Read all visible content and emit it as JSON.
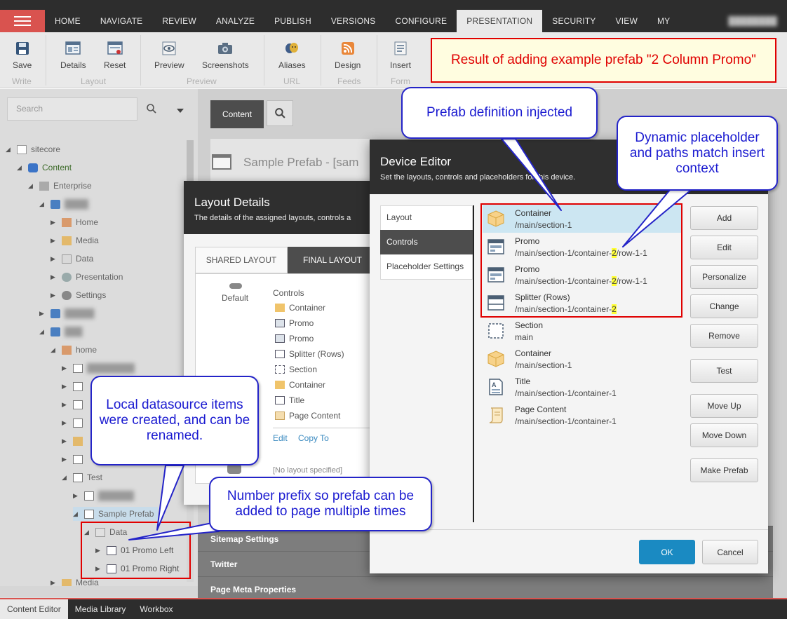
{
  "topnav": {
    "tabs": [
      "HOME",
      "NAVIGATE",
      "REVIEW",
      "ANALYZE",
      "PUBLISH",
      "VERSIONS",
      "CONFIGURE",
      "PRESENTATION",
      "SECURITY",
      "VIEW",
      "MY TOOLBAR"
    ],
    "active": "PRESENTATION"
  },
  "ribbon": {
    "buttons": {
      "save": "Save",
      "details": "Details",
      "reset": "Reset",
      "preview": "Preview",
      "screenshots": "Screenshots",
      "aliases": "Aliases",
      "design": "Design",
      "insert": "Insert"
    },
    "groups": {
      "write": "Write",
      "layout": "Layout",
      "preview": "Preview",
      "url": "URL",
      "feeds": "Feeds",
      "form": "Form"
    }
  },
  "search": {
    "placeholder": "Search"
  },
  "tree": {
    "sitecore": "sitecore",
    "content": "Content",
    "enterprise": "Enterprise",
    "home": "Home",
    "media": "Media",
    "data": "Data",
    "presentation": "Presentation",
    "settings": "Settings",
    "home_lower": "home",
    "test": "Test",
    "sample_prefab": "Sample Prefab",
    "data_folder": "Data",
    "promo_left": "01 Promo Left",
    "promo_right": "01 Promo Right",
    "media_partial": "Media"
  },
  "content_editor": {
    "content_tab": "Content",
    "item_title": "Sample Prefab - [sam",
    "sections": [
      "Sitemap Settings",
      "Twitter",
      "Page Meta Properties"
    ]
  },
  "layout_details": {
    "title": "Layout Details",
    "subtitle": "The details of the assigned layouts, controls a",
    "tab_shared": "SHARED LAYOUT",
    "tab_final": "FINAL LAYOUT",
    "device": "Default",
    "controls_label": "Controls",
    "controls": [
      "Container",
      "Promo",
      "Promo",
      "Splitter (Rows)",
      "Section",
      "Container",
      "Title",
      "Page Content"
    ],
    "edit": "Edit",
    "copy_to": "Copy To",
    "no_layout": "[No layout specified]"
  },
  "device_editor": {
    "title": "Device Editor",
    "subtitle": "Set the layouts, controls and placeholders for this device.",
    "nav": [
      "Layout",
      "Controls",
      "Placeholder Settings"
    ],
    "nav_active": "Controls",
    "controls": [
      {
        "name": "Container",
        "path_pre": "/main/section-1",
        "hl": "",
        "path_post": ""
      },
      {
        "name": "Promo",
        "path_pre": "/main/section-1/container-",
        "hl": "2",
        "path_post": "/row-1-1"
      },
      {
        "name": "Promo",
        "path_pre": "/main/section-1/container-",
        "hl": "2",
        "path_post": "/row-1-1"
      },
      {
        "name": "Splitter (Rows)",
        "path_pre": "/main/section-1/container-",
        "hl": "2",
        "path_post": ""
      },
      {
        "name": "Section",
        "path_pre": "main",
        "hl": "",
        "path_post": ""
      },
      {
        "name": "Container",
        "path_pre": "/main/section-1",
        "hl": "",
        "path_post": ""
      },
      {
        "name": "Title",
        "path_pre": "/main/section-1/container-1",
        "hl": "",
        "path_post": ""
      },
      {
        "name": "Page Content",
        "path_pre": "/main/section-1/container-1",
        "hl": "",
        "path_post": ""
      }
    ],
    "buttons": [
      "Add",
      "Edit",
      "Personalize",
      "Change",
      "Remove",
      "Test",
      "Move Up",
      "Move Down",
      "Make Prefab"
    ],
    "ok": "OK",
    "cancel": "Cancel"
  },
  "bottombar": {
    "tabs": [
      "Content Editor",
      "Media Library",
      "Workbox"
    ]
  },
  "annotations": {
    "result": "Result of adding example prefab \"2 Column Promo\"",
    "prefab_injected": "Prefab definition injected",
    "dynamic_placeholder": "Dynamic placeholder and paths match insert context",
    "local_datasource": "Local datasource items were created, and can be renamed.",
    "number_prefix": "Number prefix so prefab can be added to page multiple times"
  },
  "colors": {
    "accent_red": "#d9534f",
    "topbar": "#2d2d2d",
    "selected_row": "#cce6f2",
    "ok_button": "#1a8ac2",
    "annotation_blue": "#1a1ad0",
    "highlight_yellow": "#ffff33"
  }
}
